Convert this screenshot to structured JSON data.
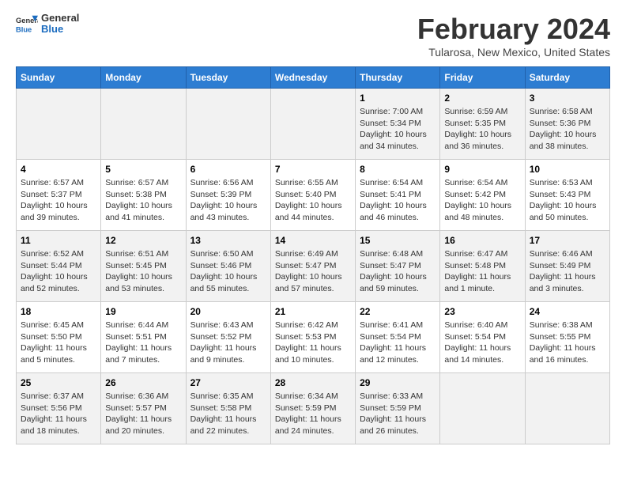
{
  "header": {
    "logo_line1": "General",
    "logo_line2": "Blue",
    "title": "February 2024",
    "subtitle": "Tularosa, New Mexico, United States"
  },
  "weekdays": [
    "Sunday",
    "Monday",
    "Tuesday",
    "Wednesday",
    "Thursday",
    "Friday",
    "Saturday"
  ],
  "weeks": [
    [
      {
        "day": "",
        "detail": ""
      },
      {
        "day": "",
        "detail": ""
      },
      {
        "day": "",
        "detail": ""
      },
      {
        "day": "",
        "detail": ""
      },
      {
        "day": "1",
        "detail": "Sunrise: 7:00 AM\nSunset: 5:34 PM\nDaylight: 10 hours\nand 34 minutes."
      },
      {
        "day": "2",
        "detail": "Sunrise: 6:59 AM\nSunset: 5:35 PM\nDaylight: 10 hours\nand 36 minutes."
      },
      {
        "day": "3",
        "detail": "Sunrise: 6:58 AM\nSunset: 5:36 PM\nDaylight: 10 hours\nand 38 minutes."
      }
    ],
    [
      {
        "day": "4",
        "detail": "Sunrise: 6:57 AM\nSunset: 5:37 PM\nDaylight: 10 hours\nand 39 minutes."
      },
      {
        "day": "5",
        "detail": "Sunrise: 6:57 AM\nSunset: 5:38 PM\nDaylight: 10 hours\nand 41 minutes."
      },
      {
        "day": "6",
        "detail": "Sunrise: 6:56 AM\nSunset: 5:39 PM\nDaylight: 10 hours\nand 43 minutes."
      },
      {
        "day": "7",
        "detail": "Sunrise: 6:55 AM\nSunset: 5:40 PM\nDaylight: 10 hours\nand 44 minutes."
      },
      {
        "day": "8",
        "detail": "Sunrise: 6:54 AM\nSunset: 5:41 PM\nDaylight: 10 hours\nand 46 minutes."
      },
      {
        "day": "9",
        "detail": "Sunrise: 6:54 AM\nSunset: 5:42 PM\nDaylight: 10 hours\nand 48 minutes."
      },
      {
        "day": "10",
        "detail": "Sunrise: 6:53 AM\nSunset: 5:43 PM\nDaylight: 10 hours\nand 50 minutes."
      }
    ],
    [
      {
        "day": "11",
        "detail": "Sunrise: 6:52 AM\nSunset: 5:44 PM\nDaylight: 10 hours\nand 52 minutes."
      },
      {
        "day": "12",
        "detail": "Sunrise: 6:51 AM\nSunset: 5:45 PM\nDaylight: 10 hours\nand 53 minutes."
      },
      {
        "day": "13",
        "detail": "Sunrise: 6:50 AM\nSunset: 5:46 PM\nDaylight: 10 hours\nand 55 minutes."
      },
      {
        "day": "14",
        "detail": "Sunrise: 6:49 AM\nSunset: 5:47 PM\nDaylight: 10 hours\nand 57 minutes."
      },
      {
        "day": "15",
        "detail": "Sunrise: 6:48 AM\nSunset: 5:47 PM\nDaylight: 10 hours\nand 59 minutes."
      },
      {
        "day": "16",
        "detail": "Sunrise: 6:47 AM\nSunset: 5:48 PM\nDaylight: 11 hours\nand 1 minute."
      },
      {
        "day": "17",
        "detail": "Sunrise: 6:46 AM\nSunset: 5:49 PM\nDaylight: 11 hours\nand 3 minutes."
      }
    ],
    [
      {
        "day": "18",
        "detail": "Sunrise: 6:45 AM\nSunset: 5:50 PM\nDaylight: 11 hours\nand 5 minutes."
      },
      {
        "day": "19",
        "detail": "Sunrise: 6:44 AM\nSunset: 5:51 PM\nDaylight: 11 hours\nand 7 minutes."
      },
      {
        "day": "20",
        "detail": "Sunrise: 6:43 AM\nSunset: 5:52 PM\nDaylight: 11 hours\nand 9 minutes."
      },
      {
        "day": "21",
        "detail": "Sunrise: 6:42 AM\nSunset: 5:53 PM\nDaylight: 11 hours\nand 10 minutes."
      },
      {
        "day": "22",
        "detail": "Sunrise: 6:41 AM\nSunset: 5:54 PM\nDaylight: 11 hours\nand 12 minutes."
      },
      {
        "day": "23",
        "detail": "Sunrise: 6:40 AM\nSunset: 5:54 PM\nDaylight: 11 hours\nand 14 minutes."
      },
      {
        "day": "24",
        "detail": "Sunrise: 6:38 AM\nSunset: 5:55 PM\nDaylight: 11 hours\nand 16 minutes."
      }
    ],
    [
      {
        "day": "25",
        "detail": "Sunrise: 6:37 AM\nSunset: 5:56 PM\nDaylight: 11 hours\nand 18 minutes."
      },
      {
        "day": "26",
        "detail": "Sunrise: 6:36 AM\nSunset: 5:57 PM\nDaylight: 11 hours\nand 20 minutes."
      },
      {
        "day": "27",
        "detail": "Sunrise: 6:35 AM\nSunset: 5:58 PM\nDaylight: 11 hours\nand 22 minutes."
      },
      {
        "day": "28",
        "detail": "Sunrise: 6:34 AM\nSunset: 5:59 PM\nDaylight: 11 hours\nand 24 minutes."
      },
      {
        "day": "29",
        "detail": "Sunrise: 6:33 AM\nSunset: 5:59 PM\nDaylight: 11 hours\nand 26 minutes."
      },
      {
        "day": "",
        "detail": ""
      },
      {
        "day": "",
        "detail": ""
      }
    ]
  ]
}
